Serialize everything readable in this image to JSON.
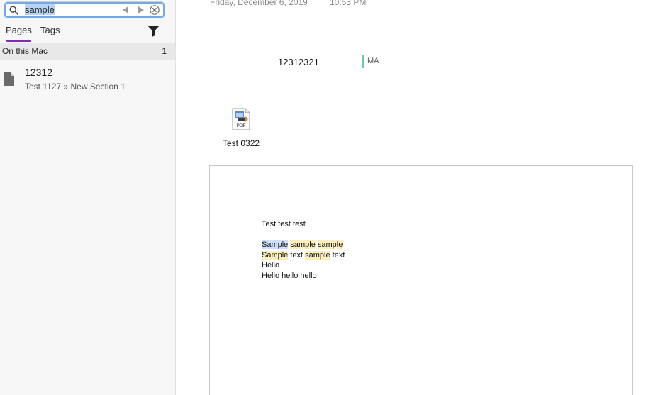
{
  "search": {
    "value": "sample",
    "prev_icon": "left-arrow-icon",
    "next_icon": "right-arrow-icon",
    "clear_icon": "clear-circle-icon"
  },
  "tabs": [
    {
      "label": "Pages",
      "active": true
    },
    {
      "label": "Tags",
      "active": false
    }
  ],
  "filter_icon": "funnel-icon",
  "accent_color": "#7a2fb0",
  "results_group": {
    "name": "On this Mac",
    "count": "1"
  },
  "results": [
    {
      "title": "12312",
      "path": "Test 1127 » New Section 1",
      "icon": "page-icon"
    }
  ],
  "page": {
    "date": "Friday, December 6, 2019",
    "time": "10:53 PM",
    "note_number": "12312321",
    "author": "MA",
    "author_color": "#6cc7ac",
    "attachment": {
      "name": "Test 0322",
      "type_label": "PDF"
    },
    "printout": {
      "lines": [
        [
          {
            "t": "Test test test"
          }
        ],
        [],
        [
          {
            "t": "Sample",
            "hl": "active"
          },
          {
            "t": " "
          },
          {
            "t": "sample",
            "hl": "match"
          },
          {
            "t": " "
          },
          {
            "t": "sample",
            "hl": "match"
          }
        ],
        [
          {
            "t": "Sample",
            "hl": "match"
          },
          {
            "t": " text "
          },
          {
            "t": "sample",
            "hl": "match"
          },
          {
            "t": " text"
          }
        ],
        [
          {
            "t": "Hello"
          }
        ],
        [
          {
            "t": "Hello hello hello"
          }
        ]
      ]
    }
  }
}
